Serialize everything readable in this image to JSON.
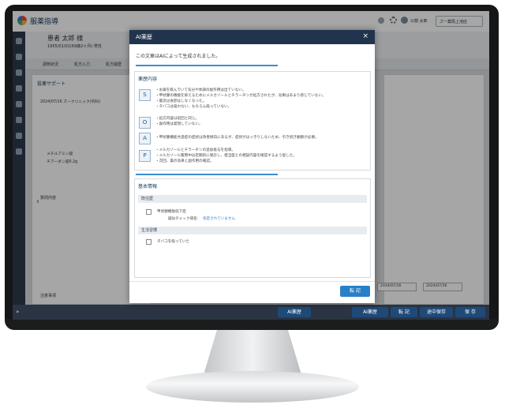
{
  "app": {
    "title": "服薬指導",
    "user_name": "公樹 太郎",
    "store_button": "ズー薬局上池店"
  },
  "patient": {
    "name": "患者 太郎 様",
    "info": "1955/01/01(69歳2ヶ月) 男性",
    "tabs": [
      "調剤状況",
      "処方入力",
      "処方履歴"
    ]
  },
  "panel": {
    "title": "投薬サポート",
    "items": [
      "2024/07/16 ズークリニック(内科)",
      "メチルアミン錠",
      "チアーダン錠0.2g"
    ],
    "inquiry_label": "質問内容",
    "special_label": "注意事項"
  },
  "modal": {
    "title": "AI薬歴",
    "close_icon": "×",
    "notice": "この文章はAIによって生成されました。",
    "section_soap": "薬歴内容",
    "soap": [
      {
        "letter": "S",
        "lines": [
          "・お薬を飲んでいて気分や体調の副作用は出ていない。",
          "・甲状腺の機能を抑えるためにメルカゾールとチラーヂンが処方されたが、効果はあまり感じていない。",
          "・最近は食欲はしなくなった。",
          "・タバコは吸わない、もちろん吸っていない。"
        ]
      },
      {
        "letter": "O",
        "lines": [
          "・処方内容は前回と同じ。",
          "・副作用は発現していない。"
        ]
      },
      {
        "letter": "A",
        "lines": [
          "・甲状腺機能亢進症の症状は改善傾向にあるが、症状がはっきりしないため、引き続き観察が必要。"
        ]
      },
      {
        "letter": "P",
        "lines": [
          "・メルカゾールとチラーヂンの追加投与を指導。",
          "・メルカゾール服用中は定期的に受診し、担当医との相談内容を確認するよう促した。",
          "・次回、薬の効果と副作用の確認。"
        ]
      }
    ],
    "section_basic": "基本情報",
    "group1": "既往歴",
    "item1": "甲状腺機能低下症",
    "item1_sub_label": "疑似チェック病名：",
    "item1_sub_value": "指定されていません",
    "group2": "生活習慣",
    "item2": "タバコを吸っていた",
    "transfer_button": "転 記"
  },
  "bottom": {
    "ai_label": "AI薬歴",
    "ai_label2": "AI薬歴",
    "transfer": "転 記",
    "temp_save": "途中保存",
    "save": "保 存"
  },
  "dates": [
    "2024/07/16",
    "2024/07/16"
  ]
}
